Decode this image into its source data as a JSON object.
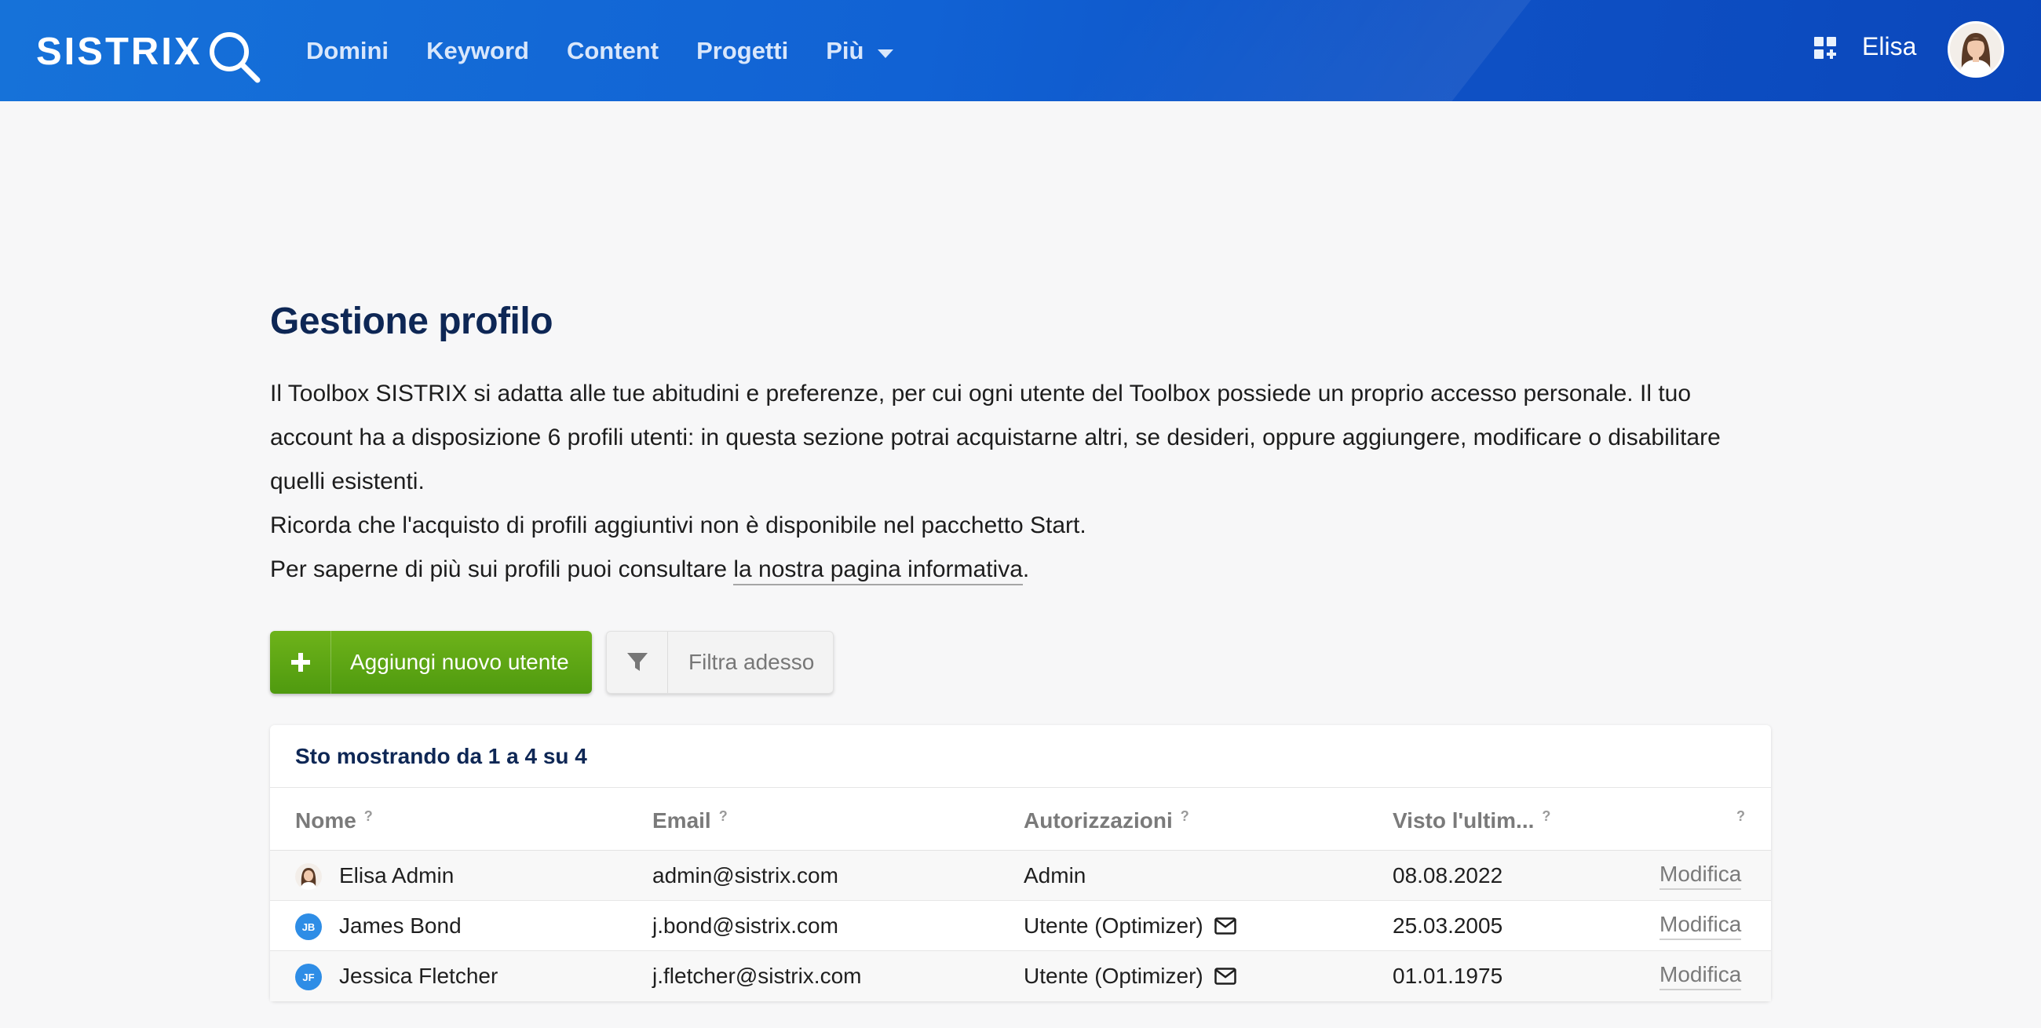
{
  "header": {
    "logo_text": "SISTRIX",
    "nav": [
      {
        "label": "Domini"
      },
      {
        "label": "Keyword"
      },
      {
        "label": "Content"
      },
      {
        "label": "Progetti"
      },
      {
        "label": "Più"
      }
    ],
    "user_name": "Elisa"
  },
  "page": {
    "title": "Gestione profilo",
    "intro_line1": "Il Toolbox SISTRIX si adatta alle tue abitudini e preferenze, per cui ogni utente del Toolbox possiede un proprio accesso personale. Il tuo account ha a disposizione 6 profili utenti: in questa sezione potrai acquistarne altri, se desideri, oppure aggiungere, modificare o disabilitare quelli esistenti.",
    "intro_line2": "Ricorda che l'acquisto di profili aggiuntivi non è disponibile nel pacchetto Start.",
    "intro_line3_prefix": "Per saperne di più sui profili puoi consultare ",
    "intro_link": "la nostra pagina informativa",
    "intro_line3_suffix": "."
  },
  "actions": {
    "add_user_label": "Aggiungi nuovo utente",
    "filter_label": "Filtra adesso"
  },
  "table": {
    "summary": "Sto mostrando da 1 a 4 su 4",
    "columns": {
      "name": "Nome",
      "email": "Email",
      "permissions": "Autorizzazioni",
      "last_seen": "Visto l'ultim...",
      "help": "?"
    },
    "rows": [
      {
        "initials": "",
        "name": "Elisa Admin",
        "email": "admin@sistrix.com",
        "permission": "Admin",
        "last_seen": "08.08.2022",
        "edit": "Modifica"
      },
      {
        "initials": "JB",
        "name": "James Bond",
        "email": "j.bond@sistrix.com",
        "permission": "Utente (Optimizer)",
        "last_seen": "25.03.2005",
        "edit": "Modifica"
      },
      {
        "initials": "JF",
        "name": "Jessica Fletcher",
        "email": "j.fletcher@sistrix.com",
        "permission": "Utente (Optimizer)",
        "last_seen": "01.01.1975",
        "edit": "Modifica"
      }
    ]
  },
  "colors": {
    "brand_blue": "#1162d4",
    "title_navy": "#0e2755",
    "add_green": "#5aa314",
    "initials_blue": "#2e8de6"
  }
}
